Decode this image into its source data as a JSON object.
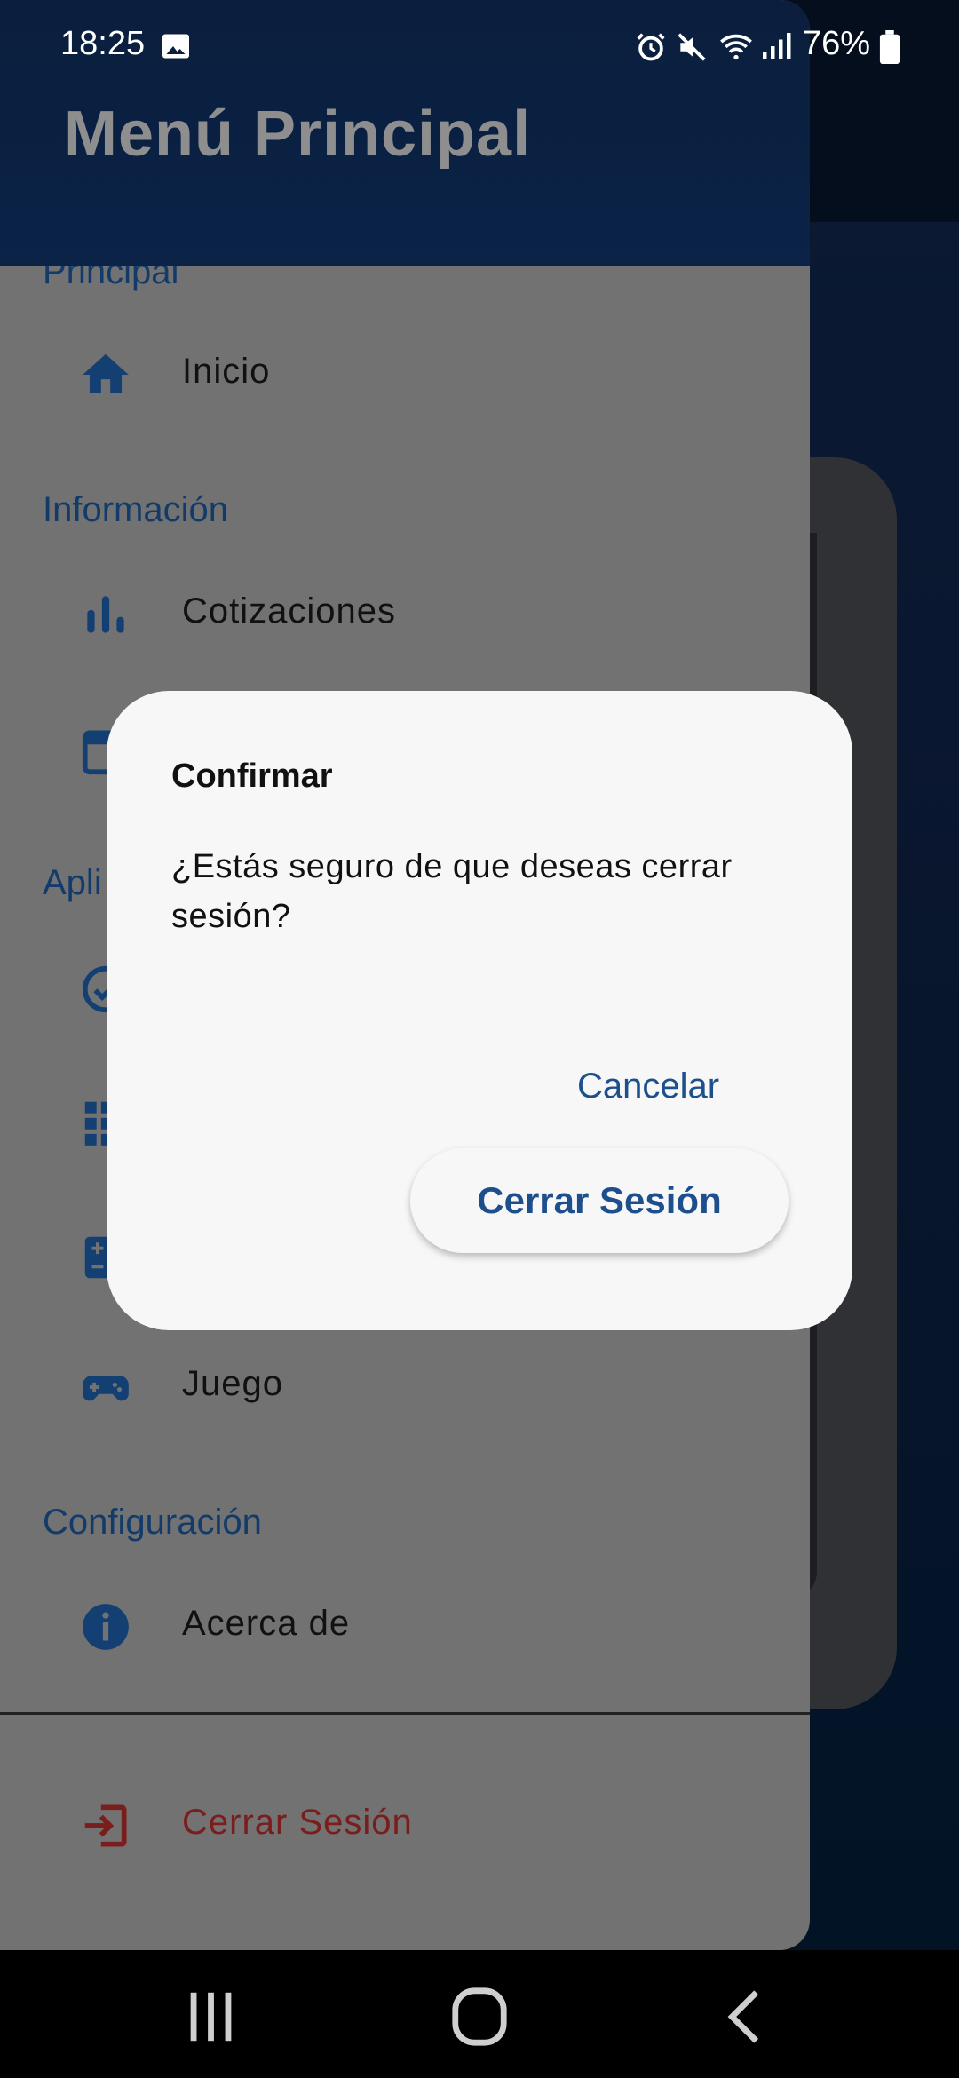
{
  "status_bar": {
    "time": "18:25",
    "battery": "76%",
    "icons": [
      "image-icon",
      "alarm-icon",
      "mute-icon",
      "wifi-icon",
      "signal-icon",
      "battery-icon"
    ]
  },
  "drawer": {
    "title": "Menú Principal",
    "sections": [
      {
        "title": "Principal",
        "items": [
          {
            "label": "Inicio",
            "icon": "home-icon"
          }
        ]
      },
      {
        "title": "Información",
        "items": [
          {
            "label": "Cotizaciones",
            "icon": "bar-chart-icon"
          },
          {
            "label": "",
            "icon": "calendar-icon"
          }
        ]
      },
      {
        "title": "Apli",
        "items": [
          {
            "label": "",
            "icon": "check-circle-icon"
          },
          {
            "label": "",
            "icon": "grid-icon"
          },
          {
            "label": "",
            "icon": "calculator-icon"
          },
          {
            "label": "Juego",
            "icon": "gamepad-icon"
          }
        ]
      },
      {
        "title": "Configuración",
        "items": [
          {
            "label": "Acerca de",
            "icon": "info-icon"
          }
        ]
      }
    ],
    "logout": {
      "label": "Cerrar Sesión",
      "icon": "logout-icon"
    }
  },
  "dialog": {
    "title": "Confirmar",
    "message": "¿Estás seguro de que deseas cerrar sesión?",
    "cancel_label": "Cancelar",
    "confirm_label": "Cerrar Sesión"
  },
  "colors": {
    "accent": "#1e4f8d",
    "section_title": "#123b6a",
    "logout": "#7a1d1d",
    "drawer_header": "#0b1e3d"
  },
  "nav_bar": {
    "buttons": [
      "recents-icon",
      "home-button-icon",
      "back-icon"
    ]
  }
}
